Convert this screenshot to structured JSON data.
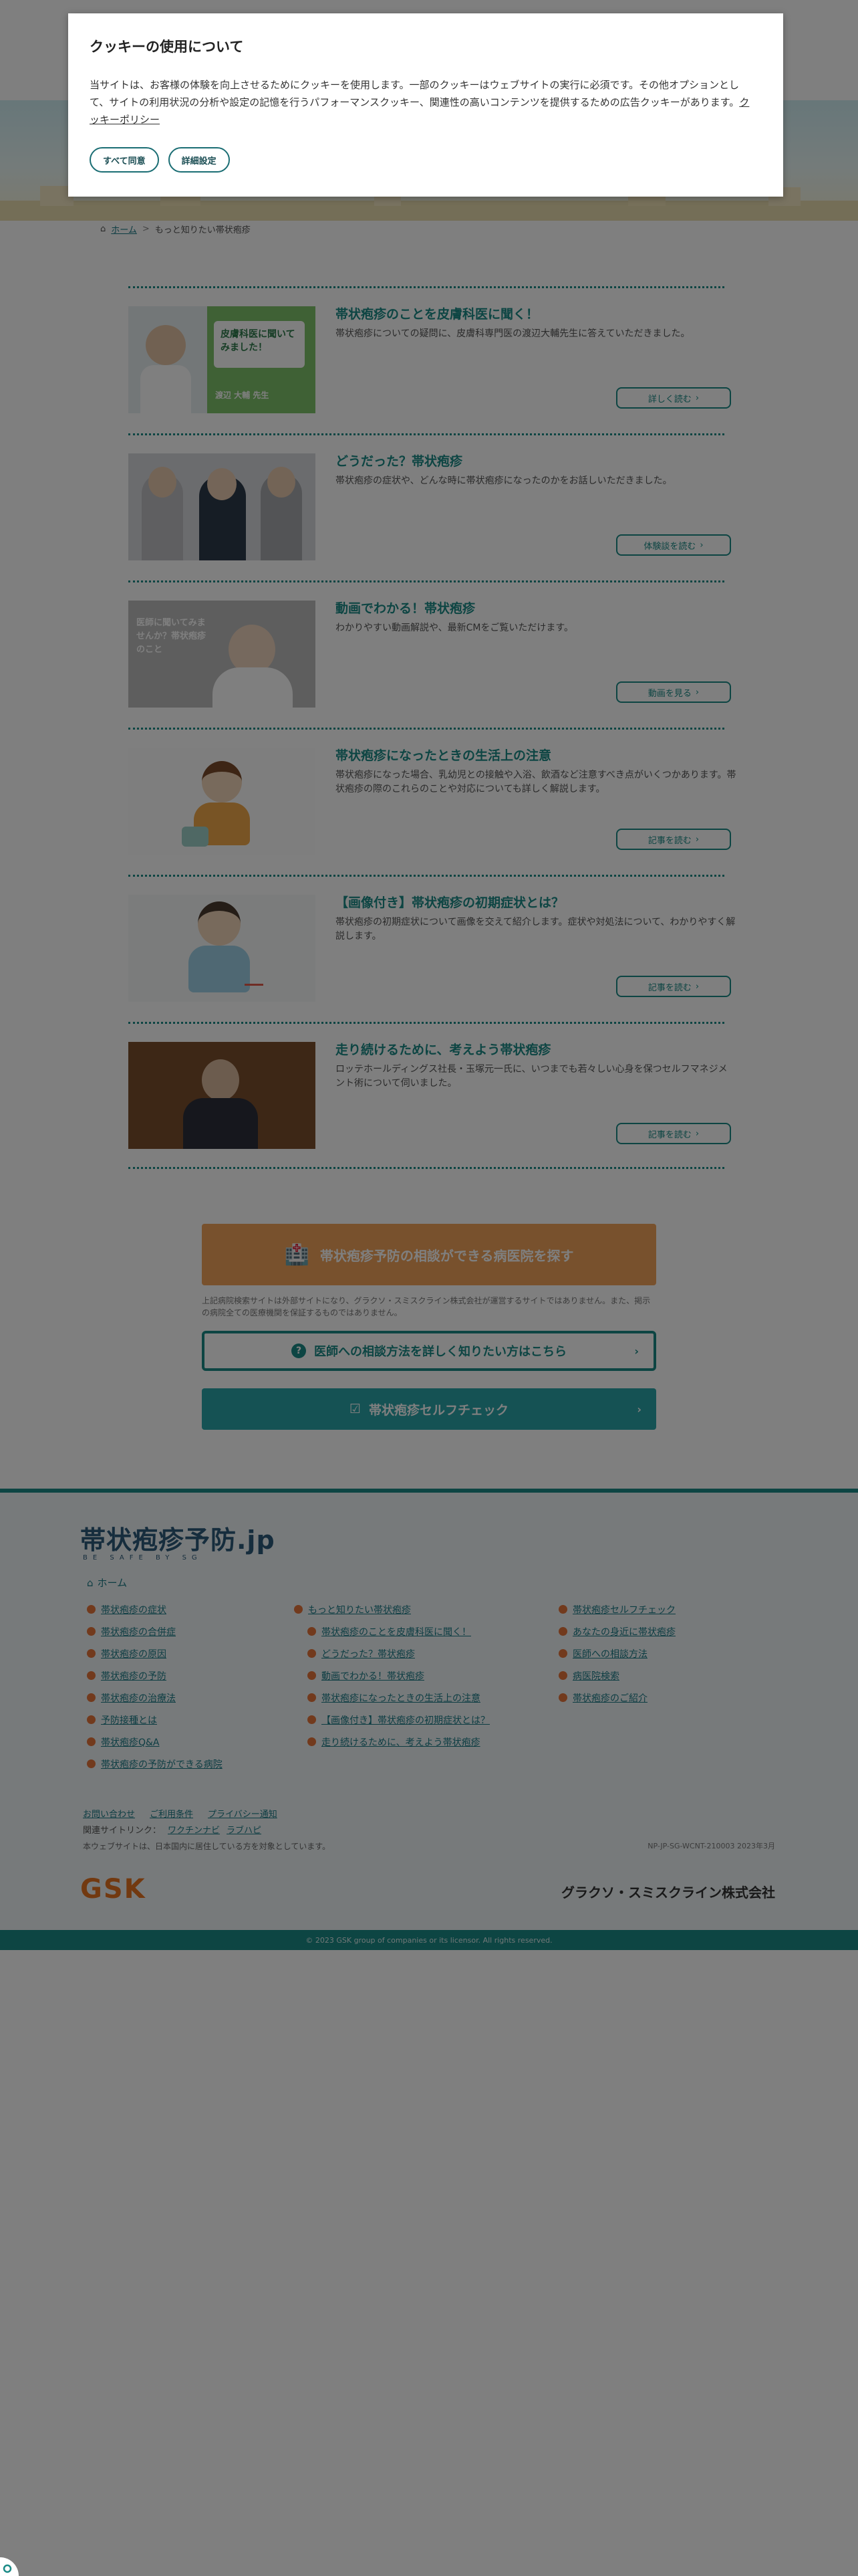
{
  "cookie_banner": {
    "title": "クッキーの使用について",
    "body": "当サイトは、お客様の体験を向上させるためにクッキーを使用します。一部のクッキーはウェブサイトの実行に必須です。その他オプションとして、サイトの利用状況の分析や設定の記憶を行うパフォーマンスクッキー、関連性の高いコンテンツを提供するための広告クッキーがあります。",
    "policy_link": "クッキーポリシー",
    "accept_all": "すべて同意",
    "settings": "詳細設定"
  },
  "breadcrumb": {
    "home": "ホーム",
    "current": "もっと知りたい帯状疱疹"
  },
  "articles": [
    {
      "title": "帯状疱疹のことを皮膚科医に聞く！",
      "desc": "帯状疱疹についての疑問に、皮膚科専門医の渡辺大輔先生に答えていただきました。",
      "button": "詳しく読む",
      "thumb_text": "皮膚科医に聞いてみました！",
      "thumb_name": "渡辺 大輔 先生"
    },
    {
      "title": "どうだった？帯状疱疹",
      "desc": "帯状疱疹の症状や、どんな時に帯状疱疹になったのかをお話しいただきました。",
      "button": "体験談を読む"
    },
    {
      "title": "動画でわかる！帯状疱疹",
      "desc": "わかりやすい動画解説や、最新CMをご覧いただけます。",
      "button": "動画を見る",
      "thumb_text": "医師に聞いてみませんか？帯状疱疹のこと"
    },
    {
      "title": "帯状疱疹になったときの生活上の注意",
      "desc": "帯状疱疹になった場合、乳幼児との接触や入浴、飲酒など注意すべき点がいくつかあります。帯状疱疹の際のこれらのことや対応についても詳しく解説します。",
      "button": "記事を読む"
    },
    {
      "title": "【画像付き】帯状疱疹の初期症状とは？",
      "desc": "帯状疱疹の初期症状について画像を交えて紹介します。症状や対処法について、わかりやすく解説します。",
      "button": "記事を読む"
    },
    {
      "title": "走り続けるために、考えよう帯状疱疹",
      "desc": "ロッテホールディングス社長・玉塚元一氏に、いつまでも若々しい心身を保つセルフマネジメント術について伺いました。",
      "button": "記事を読む"
    }
  ],
  "cta": {
    "find_clinic": "帯状疱疹予防の相談ができる病医院を探す",
    "note": "上記病院検索サイトは外部サイトになり、グラクソ・スミスクライン株式会社が運営するサイトではありません。また、掲示の病院全ての医療機関を保証するものではありません。",
    "doctor_consult": "医師への相談方法を詳しく知りたい方はこちら",
    "self_check": "帯状疱疹セルフチェック"
  },
  "footer": {
    "logo": "帯状疱疹予防.jp",
    "logo_sub": "BE SAFE BY SG",
    "home": "ホーム",
    "col1": [
      "帯状疱疹の症状",
      "帯状疱疹の合併症",
      "帯状疱疹の原因",
      "帯状疱疹の予防",
      "帯状疱疹の治療法",
      "予防接種とは",
      "帯状疱疹Q&A",
      "帯状疱疹の予防ができる病院"
    ],
    "col2_head": "もっと知りたい帯状疱疹",
    "col2": [
      "帯状疱疹のことを皮膚科医に聞く！",
      "どうだった？帯状疱疹",
      "動画でわかる！帯状疱疹",
      "帯状疱疹になったときの生活上の注意",
      "【画像付き】帯状疱疹の初期症状とは？",
      "走り続けるために、考えよう帯状疱疹"
    ],
    "col3": [
      "帯状疱疹セルフチェック",
      "あなたの身近に帯状疱疹",
      "医師への相談方法",
      "病医院検索",
      "帯状疱疹のご紹介"
    ],
    "links": [
      "お問い合わせ",
      "ご利用条件",
      "プライバシー通知"
    ],
    "related_label": "関連サイトリンク：",
    "related": [
      "ワクチンナビ",
      "ラブハピ"
    ],
    "notice": "本ウェブサイトは、日本国内に居住している方を対象としています。",
    "code": "NP-JP-SG-WCNT-210003 2023年3月",
    "gsk": "GSK",
    "company": "グラクソ・スミスクライン株式会社",
    "copyright": "© 2023 GSK group of companies or its licensor. All rights reserved."
  },
  "colors": {
    "accent": "#1b8a86",
    "orange": "#f0a35a",
    "teal": "#2aa5a8",
    "overlay": "rgba(0,0,0,0.5)"
  }
}
